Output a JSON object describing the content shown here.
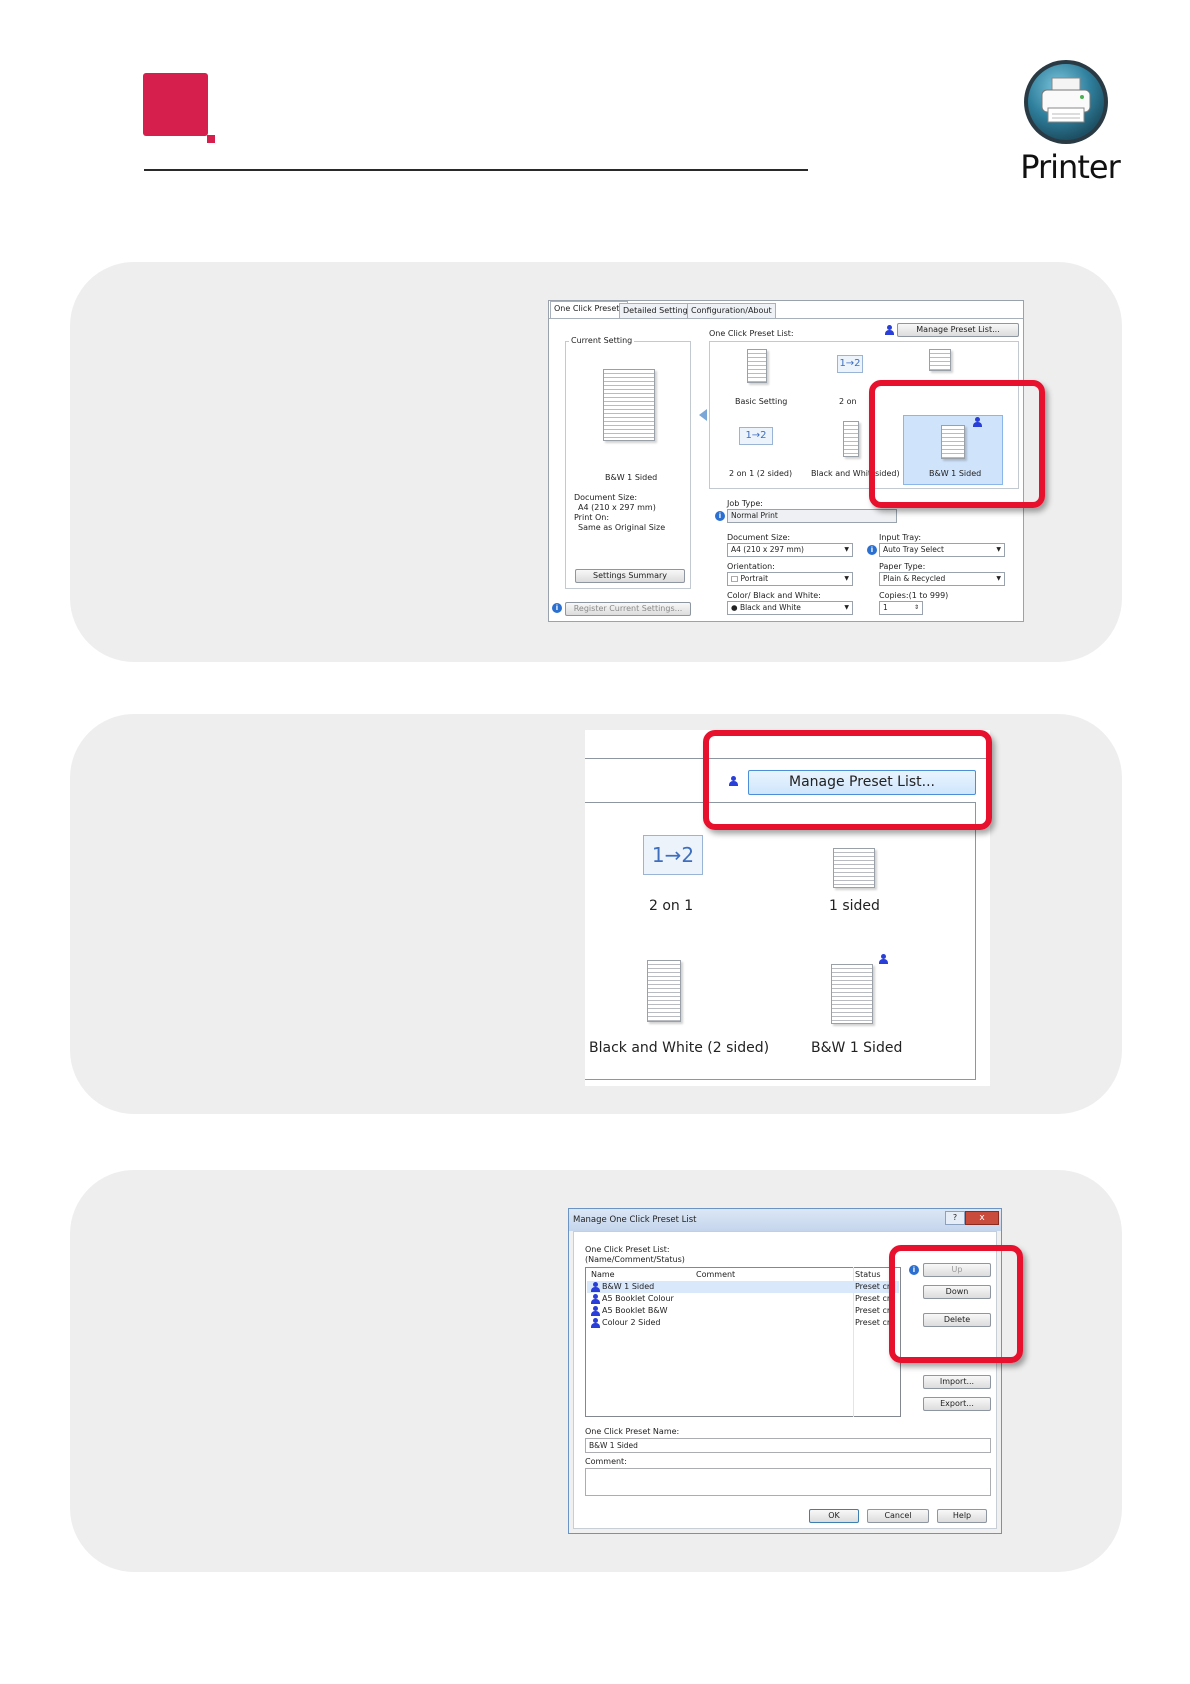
{
  "header": {
    "badge_label": "Printer",
    "brand_color": "#d71f4d"
  },
  "step1": {
    "tabs": [
      "One Click Presets",
      "Detailed Settings",
      "Configuration/About"
    ],
    "current_setting_label": "Current Setting",
    "preview_caption": "B&W 1 Sided",
    "document_size_label": "Document Size:",
    "document_size_value": "A4 (210 x 297 mm)",
    "print_on_label": "Print On:",
    "print_on_value": "Same as Original Size",
    "settings_summary_button": "Settings Summary",
    "register_button": "Register Current Settings...",
    "preset_list_label": "One Click Preset List:",
    "manage_button": "Manage Preset List...",
    "presets": [
      {
        "label": "Basic Setting"
      },
      {
        "label": "2 on"
      },
      {
        "label": ""
      },
      {
        "label": "2 on 1 (2 sided)"
      },
      {
        "label": "Black and Whit"
      },
      {
        "label": "sided)"
      },
      {
        "label": "B&W 1 Sided"
      }
    ],
    "n_up_glyph": "1→2",
    "job_type_label": "Job Type:",
    "job_type_value": "Normal Print",
    "document_size_field_label": "Document Size:",
    "document_size_field_value": "A4 (210 x 297 mm)",
    "orientation_label": "Orientation:",
    "orientation_value": "Portrait",
    "color_label": "Color/ Black and White:",
    "color_value": "Black and White",
    "input_tray_label": "Input Tray:",
    "input_tray_value": "Auto Tray Select",
    "paper_type_label": "Paper Type:",
    "paper_type_value": "Plain & Recycled",
    "copies_label": "Copies:(1 to 999)",
    "copies_value": "1"
  },
  "step2": {
    "manage_button": "Manage Preset List...",
    "n_up_glyph": "1→2",
    "items": [
      {
        "label": "2 on 1"
      },
      {
        "label": "1 sided"
      },
      {
        "label": "Black and White (2 sided)"
      },
      {
        "label": "B&W 1 Sided"
      }
    ]
  },
  "step3": {
    "title": "Manage One Click Preset List",
    "help_glyph": "?",
    "close_glyph": "x",
    "list_label": "One Click Preset List:",
    "list_sublabel": "(Name/Comment/Status)",
    "columns": [
      "Name",
      "Comment",
      "Status"
    ],
    "rows": [
      {
        "name": "B&W 1 Sided",
        "status": "Preset cr"
      },
      {
        "name": "A5 Booklet Colour",
        "status": "Preset cr"
      },
      {
        "name": "A5 Booklet B&W",
        "status": "Preset cr"
      },
      {
        "name": "Colour 2 Sided",
        "status": "Preset cr"
      }
    ],
    "buttons": {
      "up": "Up",
      "down": "Down",
      "delete": "Delete",
      "import": "Import...",
      "export": "Export...",
      "ok": "OK",
      "cancel": "Cancel",
      "help": "Help"
    },
    "name_label": "One Click Preset Name:",
    "name_value": "B&W 1 Sided",
    "comment_label": "Comment:",
    "comment_value": ""
  }
}
